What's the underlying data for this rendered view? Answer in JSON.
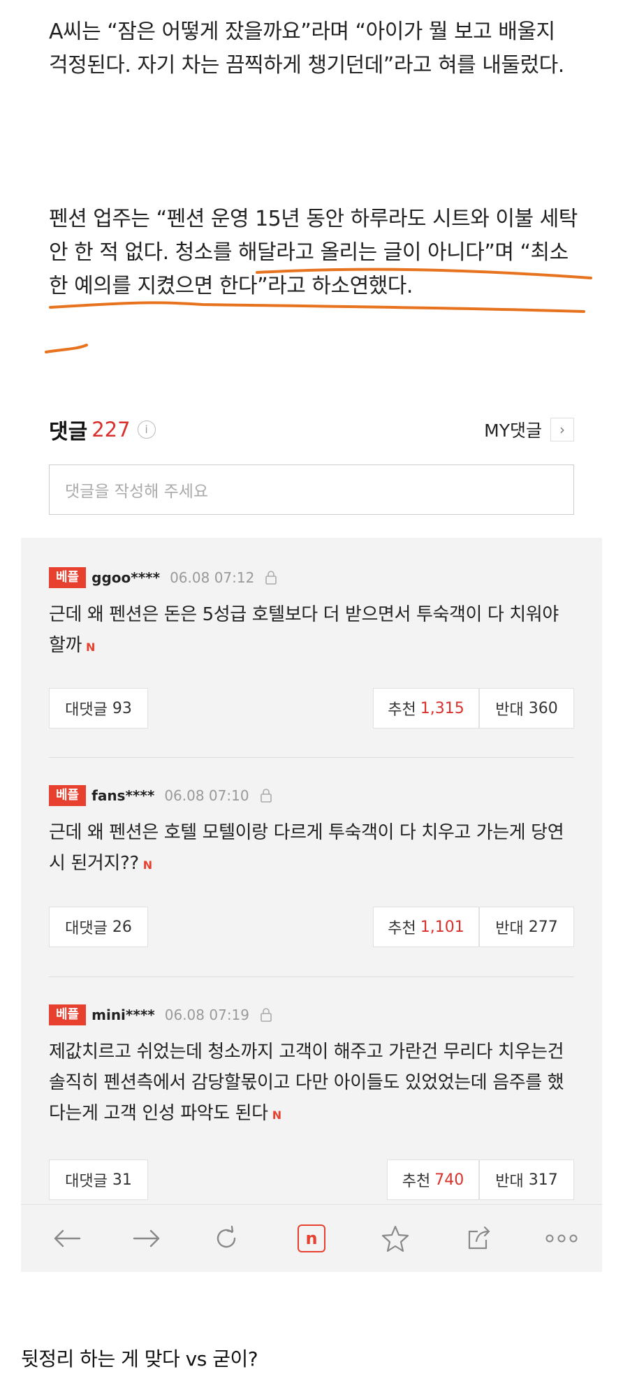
{
  "article": {
    "para1": "A씨는 “잠은 어떻게 잤을까요”라며 “아이가 뭘 보고 배울지 걱정된다. 자기 차는 끔찍하게 챙기던데”라고 혀를 내둘렀다.",
    "para2": "펜션 업주는 “펜션 운영 15년 동안 하루라도 시트와 이불 세탁 안 한 적 없다. 청소를 해달라고 올리는 글이 아니다”며 “최소한 예의를 지켰으면 한다”라고 하소연했다."
  },
  "comments_header": {
    "title": "댓글",
    "count": "227",
    "info_glyph": "i",
    "my_comments_label": "MY댓글",
    "chevron": "›"
  },
  "comment_input": {
    "placeholder": "댓글을 작성해 주세요"
  },
  "comments": [
    {
      "badge": "베플",
      "user": "ggoo****",
      "time": "06.08 07:12",
      "text": "근데 왜 펜션은 돈은 5성급 호텔보다 더 받으면서 투숙객이 다 치워야 할까",
      "new_mark": "N",
      "reply_label": "대댓글",
      "reply_count": "93",
      "up_label": "추천",
      "up_count": "1,315",
      "down_label": "반대",
      "down_count": "360"
    },
    {
      "badge": "베플",
      "user": "fans****",
      "time": "06.08 07:10",
      "text": "근데 왜 펜션은 호텔 모텔이랑 다르게 투숙객이 다 치우고 가는게 당연시 된거지??",
      "new_mark": "N",
      "reply_label": "대댓글",
      "reply_count": "26",
      "up_label": "추천",
      "up_count": "1,101",
      "down_label": "반대",
      "down_count": "277"
    },
    {
      "badge": "베플",
      "user": "mini****",
      "time": "06.08 07:19",
      "text": "제값치르고 쉬었는데 청소까지 고객이 해주고 가란건 무리다 치우는건 솔직히 펜션측에서 감당할몫이고 다만 아이들도 있었었는데 음주를 했다는게 고객 인성 파악도 된다",
      "new_mark": "N",
      "reply_label": "대댓글",
      "reply_count": "31",
      "up_label": "추천",
      "up_count": "740",
      "down_label": "반대",
      "down_count": "317"
    }
  ],
  "toolbar": {
    "naver_glyph": "n",
    "icons": [
      "back-arrow-icon",
      "forward-arrow-icon",
      "refresh-icon",
      "naver-home-icon",
      "star-icon",
      "share-icon",
      "more-icon"
    ]
  },
  "caption": "뒷정리 하는 게 맞다 vs 굳이?",
  "colors": {
    "accent_red": "#d9302c",
    "badge_red": "#e8402f",
    "underline_orange": "#e8731f",
    "panel_gray": "#f3f3f3"
  }
}
